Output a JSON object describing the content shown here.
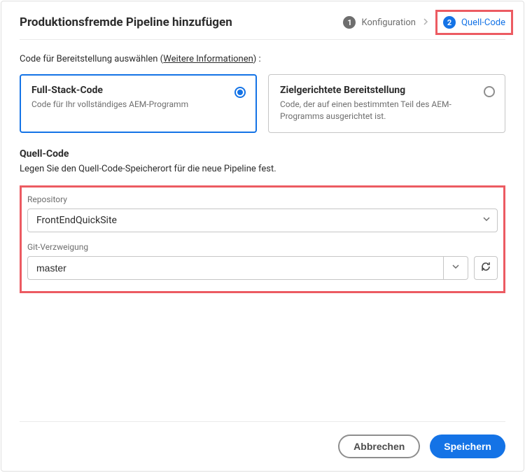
{
  "header": {
    "title": "Produktionsfremde Pipeline hinzufügen"
  },
  "stepper": {
    "step1": {
      "num": "1",
      "label": "Konfiguration"
    },
    "step2": {
      "num": "2",
      "label": "Quell-Code"
    }
  },
  "codeSelect": {
    "intro_prefix": "Code für Bereitstellung auswählen  (",
    "intro_link": "Weitere Informationen",
    "intro_suffix": ") :",
    "options": [
      {
        "title": "Full-Stack-Code",
        "desc": "Code für Ihr vollständiges AEM-Programm",
        "selected": true
      },
      {
        "title": "Zielgerichtete Bereitstellung",
        "desc": "Code, der auf einen bestimmten Teil des AEM-Programms ausgerichtet ist.",
        "selected": false
      }
    ]
  },
  "sourceCode": {
    "heading": "Quell-Code",
    "subheading": "Legen Sie den Quell-Code-Speicherort für die neue Pipeline fest.",
    "repo": {
      "label": "Repository",
      "value": "FrontEndQuickSite"
    },
    "branch": {
      "label": "Git-Verzweigung",
      "value": "master"
    }
  },
  "footer": {
    "cancel": "Abbrechen",
    "save": "Speichern"
  },
  "colors": {
    "accent": "#1473e6",
    "highlight": "#ec5b62"
  }
}
